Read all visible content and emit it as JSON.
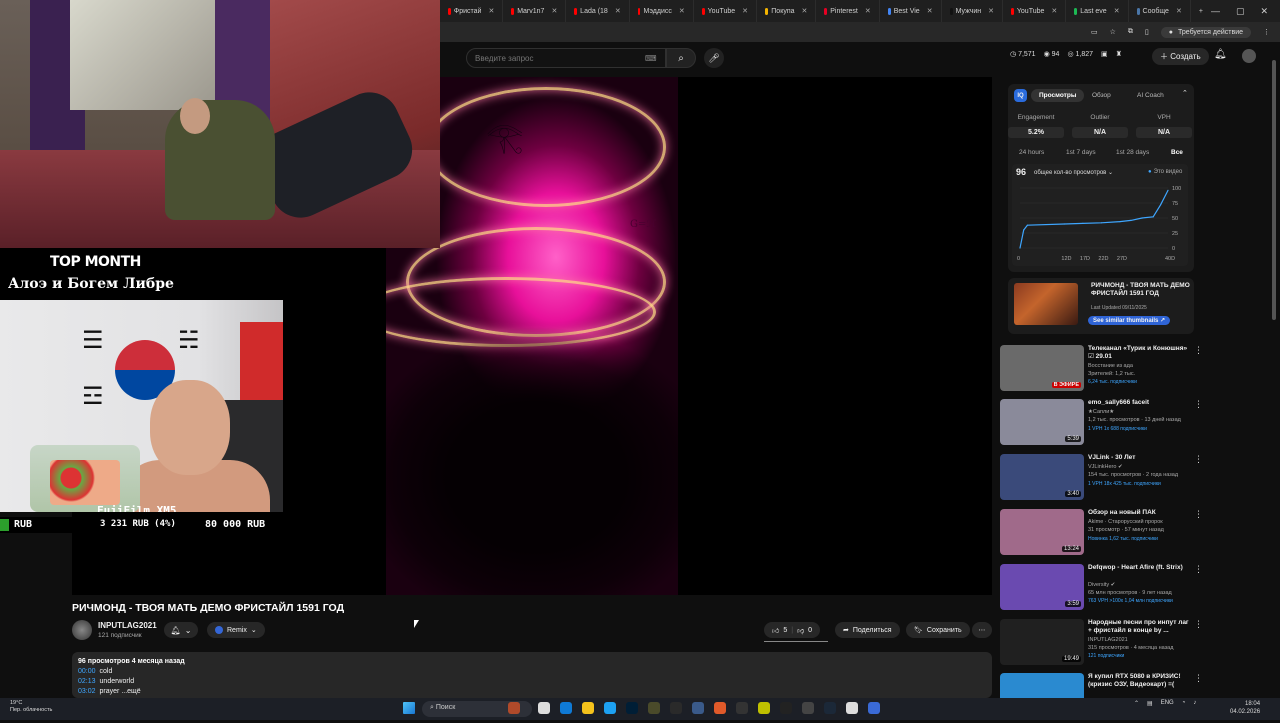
{
  "browser": {
    "tabs": [
      {
        "label": "Фристай",
        "color": "#ff0000"
      },
      {
        "label": "Marv1n7",
        "color": "#ff0000"
      },
      {
        "label": "Lada (18",
        "color": "#ff0000"
      },
      {
        "label": "Мэддисс",
        "color": "#ff0000"
      },
      {
        "label": "YouTube",
        "color": "#ff0000"
      },
      {
        "label": "Покупа",
        "color": "#f4b400"
      },
      {
        "label": "Pinterest",
        "color": "#e60023"
      },
      {
        "label": "Best Vie",
        "color": "#4285f4"
      },
      {
        "label": "Мужчин",
        "color": "#111111"
      },
      {
        "label": "YouTube",
        "color": "#ff0000"
      },
      {
        "label": "Last eve",
        "color": "#1db954"
      },
      {
        "label": "Сообще",
        "color": "#4a76a8"
      }
    ],
    "action_required": "Требуется действие"
  },
  "header": {
    "search_placeholder": "Введите запрос",
    "stats": [
      "7,571",
      "94",
      "1,827"
    ],
    "create_label": "Создать"
  },
  "overlay": {
    "top_month_title": "TOP MONTH",
    "top_month_name": "Алоэ и Богем Либре",
    "camera_label": "FujiFilm XM5",
    "donation_current": "RUB",
    "donation_progress": "3 231 RUB (4%)",
    "donation_goal": "80 000 RUB",
    "video_watermark": "G=ℋ"
  },
  "video": {
    "title": "РИЧМОНД - ТВОЯ МАТЬ ДЕМО ФРИСТАЙЛ 1591 ГОД",
    "channel": "INPUTLAG2021",
    "subscribers": "121 подписчик",
    "remix_label": "Remix",
    "likes": "5",
    "dislikes": "0",
    "share_label": "Поделиться",
    "save_label": "Сохранить",
    "description_meta": "96 просмотров  4 месяца назад",
    "chapters": [
      {
        "time": "00:00",
        "label": "cold"
      },
      {
        "time": "02:13",
        "label": "underworld"
      },
      {
        "time": "03:02",
        "label": "prayer ...ещё"
      }
    ]
  },
  "vidiq": {
    "logo": "IQ",
    "tabs": [
      "Просмотры",
      "Обзор",
      "AI Coach"
    ],
    "metrics": [
      {
        "label": "Engagement",
        "value": "5.2%"
      },
      {
        "label": "Outlier",
        "value": "N/A"
      },
      {
        "label": "VPH",
        "value": "N/A"
      }
    ],
    "ranges": [
      "24 hours",
      "1st 7 days",
      "1st 28 days",
      "Все"
    ],
    "count": "96",
    "metric_select": "общее кол-во просмотров ⌄",
    "legend": "Это видео",
    "thumb_title": "РИЧМОНД - ТВОЯ МАТЬ ДЕМО ФРИСТАЙЛ 1591 ГОД",
    "thumb_date": "Last Updated 09/11/2025",
    "thumb_button": "See similar thumbnails ↗"
  },
  "chart_data": {
    "type": "line",
    "x": [
      0,
      1,
      2,
      12,
      17,
      22,
      27,
      30,
      33,
      36,
      38,
      40
    ],
    "y": [
      0,
      30,
      38,
      40,
      41,
      42,
      44,
      46,
      50,
      52,
      72,
      96
    ],
    "xticks": [
      "0",
      "12D",
      "17D",
      "22D",
      "27D",
      "40D"
    ],
    "xtick_values": [
      0,
      12,
      17,
      22,
      27,
      40
    ],
    "yticks": [
      0,
      25,
      50,
      75,
      100
    ],
    "ylim": [
      0,
      100
    ],
    "xlim": [
      0,
      40
    ],
    "series": [
      {
        "name": "Это видео"
      }
    ],
    "color": "#3ea6ff"
  },
  "recommendations": [
    {
      "title": "Телеканал «Турик и Конюшня» ☑ 29.01",
      "channel": "Восстание из ада",
      "meta": "Зрителей: 1,2 тыс.",
      "subs": "6,24 тыс. подписчики",
      "badge": "В ЭФИРЕ",
      "thumb": "#6a6a6a"
    },
    {
      "title": "emo_sally666 faceit",
      "channel": "★Сапли★",
      "meta": "1,2 тыс. просмотров · 13 дней назад",
      "subs": "1 VPH  1x  688 подписчики",
      "badge": "5:39",
      "thumb": "#8a8a9a"
    },
    {
      "title": "VJLink - 30 Лет",
      "channel": "VJLinkHero ✔",
      "meta": "154 тыс. просмотров · 2 года назад",
      "subs": "1 VPH  18x  425 тыс. подписчики",
      "badge": "3:40",
      "thumb": "#3a4a7a"
    },
    {
      "title": "Обзор на новый ПАК",
      "channel": "Akime · Старорусский пророк",
      "meta": "31 просмотр · 57 минут назад",
      "subs": "Новинка  1,62 тыс. подписчики",
      "badge": "13:24",
      "thumb": "#a06a8a"
    },
    {
      "title": "Defqwop - Heart Afire (ft. Strix)",
      "channel": "Diversity ✔",
      "meta": "65 млн просмотров · 9 лет назад",
      "subs": "763 VPH  >100x  1,04 млн подписчики",
      "badge": "3:59",
      "thumb": "#6a4ab0"
    },
    {
      "title": "Народные песни про инпут лаг + фристайл в конце by ...",
      "channel": "INPUTLAG2021",
      "meta": "315 просмотров · 4 месяца назад",
      "subs": "121 подписчики",
      "badge": "19:49",
      "thumb": "#202020"
    },
    {
      "title": "Я купил RTX 5080 в КРИЗИС! (кризис ОЗУ, Видеокарт) =(",
      "channel": "",
      "meta": "",
      "subs": "",
      "badge": "",
      "thumb": "#2a8ad0"
    }
  ],
  "taskbar": {
    "weather_temp": "19°C",
    "weather_desc": "Пер. облачность",
    "search_label": "Поиск",
    "lang": "ENG",
    "time": "18:04",
    "date": "04.02.2026"
  }
}
